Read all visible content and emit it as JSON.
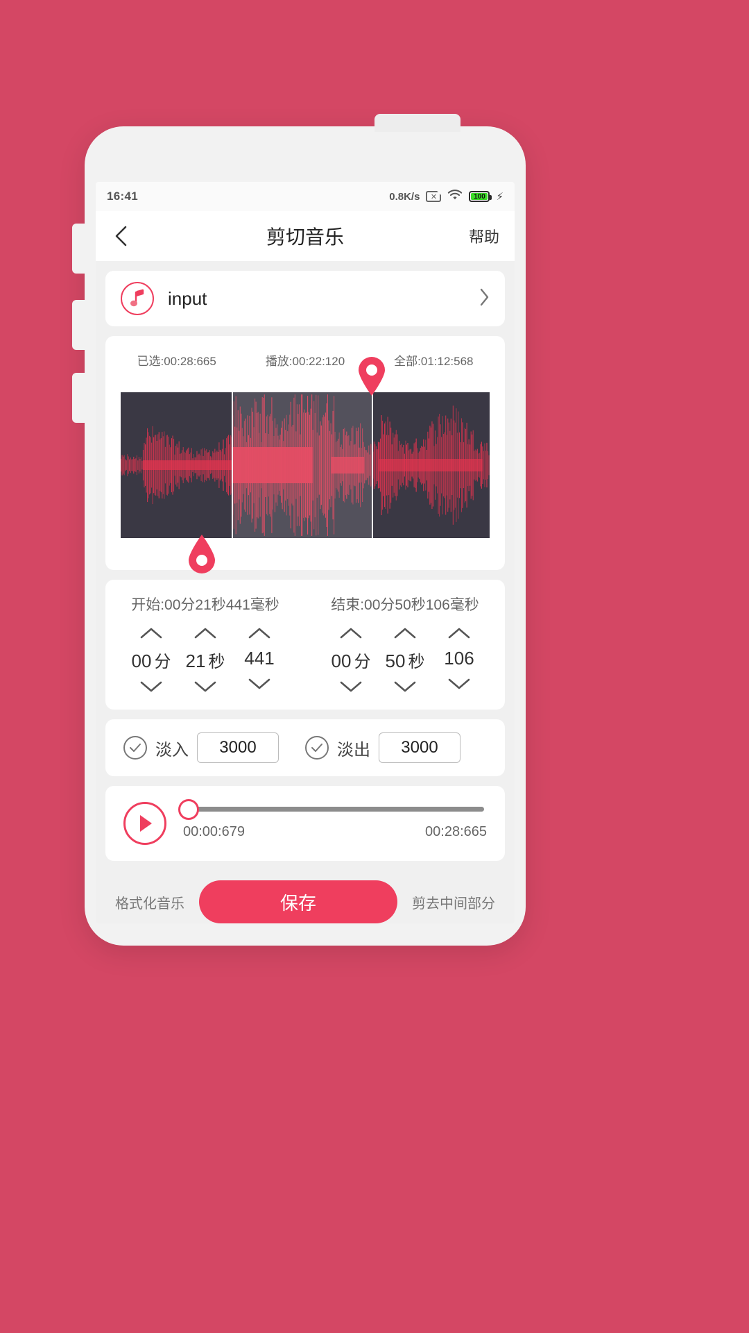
{
  "status_bar": {
    "clock": "16:41",
    "net_speed": "0.8K/s",
    "sim_icon": "sim-no-signal-icon",
    "wifi_icon": "wifi-icon",
    "battery_level": "100",
    "charging_icon": "lightning-bolt-icon"
  },
  "header": {
    "back_icon": "chevron-left-icon",
    "title": "剪切音乐",
    "help_label": "帮助"
  },
  "file_row": {
    "icon": "music-note-icon",
    "name": "input",
    "chevron": "chevron-right-icon"
  },
  "waveform": {
    "selected_label": "已选:00:28:665",
    "playing_label": "播放:00:22:120",
    "total_label": "全部:01:12:568",
    "start_marker_pct": 22,
    "end_marker_pct": 68,
    "selection_left_pct": 30,
    "selection_right_pct": 68,
    "bg_color": "#3a3844",
    "wave_color": "#e0344f",
    "accent": "#ef3e5e"
  },
  "time_editor": {
    "start_label": "开始:00分21秒441毫秒",
    "end_label": "结束:00分50秒106毫秒",
    "start": {
      "minutes": "00",
      "minutes_unit": "分",
      "seconds": "21",
      "seconds_unit": "秒",
      "millis": "441"
    },
    "end": {
      "minutes": "00",
      "minutes_unit": "分",
      "seconds": "50",
      "seconds_unit": "秒",
      "millis": "106"
    },
    "up_icon": "chevron-up-icon",
    "down_icon": "chevron-down-icon"
  },
  "fade": {
    "fade_in_label": "淡入",
    "fade_in_value": "3000",
    "fade_out_label": "淡出",
    "fade_out_value": "3000",
    "check_icon": "check-circle-icon"
  },
  "player": {
    "play_icon": "play-icon",
    "position_pct": 1,
    "current_time": "00:00:679",
    "total_time": "00:28:665"
  },
  "bottom_actions": {
    "left_label": "格式化音乐",
    "save_label": "保存",
    "right_label": "剪去中间部分"
  }
}
